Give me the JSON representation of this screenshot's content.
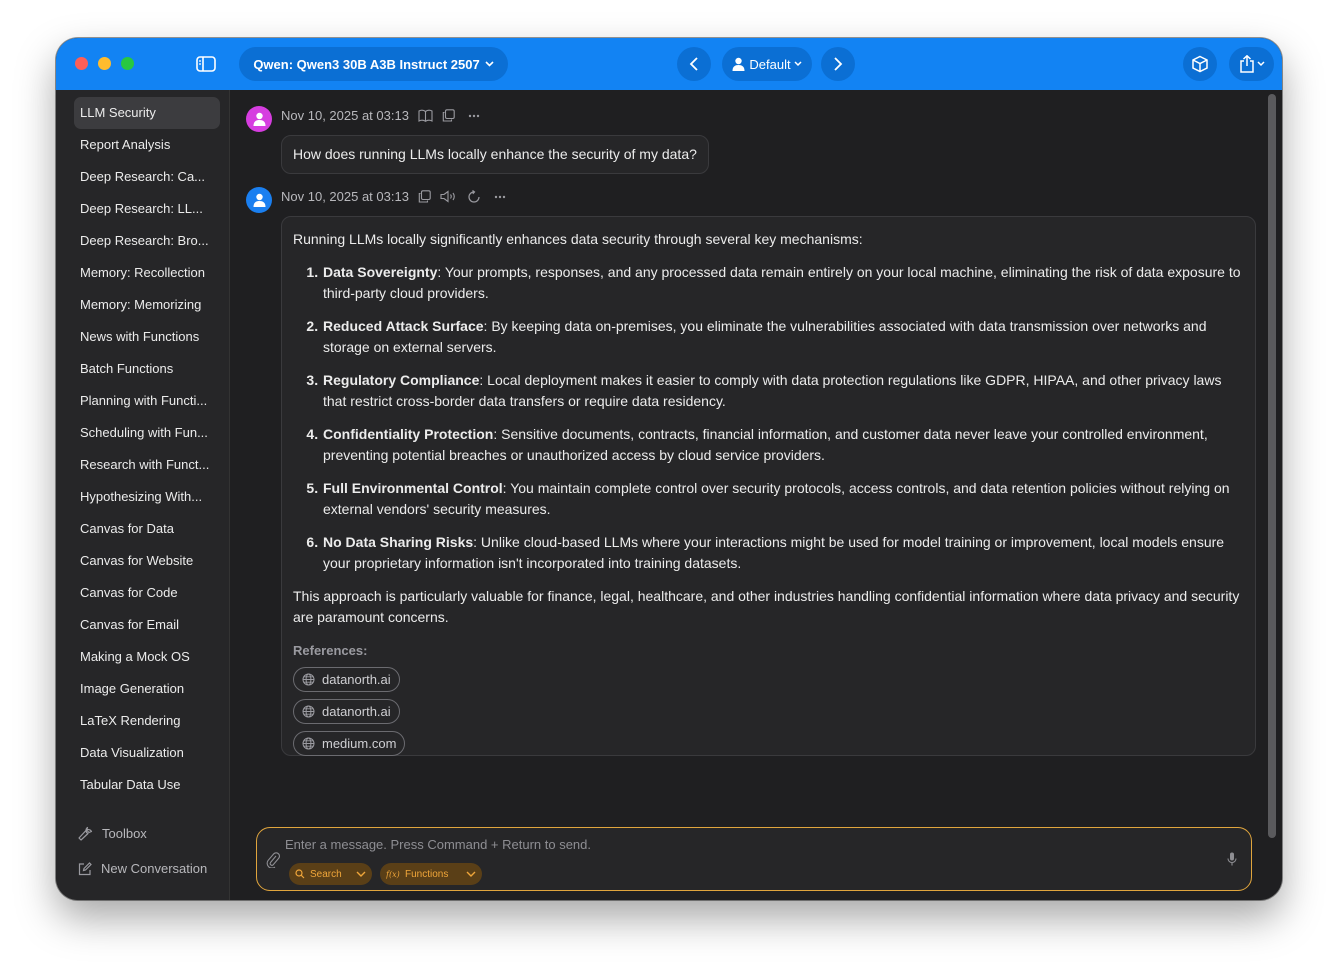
{
  "toolbar": {
    "model_label": "Qwen: Qwen3 30B A3B Instruct 2507",
    "profile_label": "Default"
  },
  "sidebar": {
    "items": [
      {
        "label": "LLM Security",
        "active": true
      },
      {
        "label": "Report Analysis"
      },
      {
        "label": "Deep Research: Ca..."
      },
      {
        "label": "Deep Research: LL..."
      },
      {
        "label": "Deep Research: Bro..."
      },
      {
        "label": "Memory: Recollection"
      },
      {
        "label": "Memory: Memorizing"
      },
      {
        "label": "News with Functions"
      },
      {
        "label": "Batch Functions"
      },
      {
        "label": "Planning with Functi..."
      },
      {
        "label": "Scheduling with Fun..."
      },
      {
        "label": "Research with Funct..."
      },
      {
        "label": "Hypothesizing With..."
      },
      {
        "label": "Canvas for Data"
      },
      {
        "label": "Canvas for Website"
      },
      {
        "label": "Canvas for Code"
      },
      {
        "label": "Canvas for Email"
      },
      {
        "label": "Making a Mock OS"
      },
      {
        "label": "Image Generation"
      },
      {
        "label": "LaTeX Rendering"
      },
      {
        "label": "Data Visualization"
      },
      {
        "label": "Tabular Data Use"
      }
    ],
    "toolbox_label": "Toolbox",
    "new_conversation_label": "New Conversation"
  },
  "conversation": {
    "user_message": {
      "timestamp": "Nov 10, 2025 at 03:13",
      "text": "How does running LLMs locally enhance the security of my data?"
    },
    "assistant_message": {
      "timestamp": "Nov 10, 2025 at 03:13",
      "intro": "Running LLMs locally significantly enhances data security through several key mechanisms:",
      "points": [
        {
          "title": "Data Sovereignty",
          "text": ": Your prompts, responses, and any processed data remain entirely on your local machine, eliminating the risk of data exposure to third-party cloud providers."
        },
        {
          "title": "Reduced Attack Surface",
          "text": ": By keeping data on-premises, you eliminate the vulnerabilities associated with data transmission over networks and storage on external servers."
        },
        {
          "title": "Regulatory Compliance",
          "text": ": Local deployment makes it easier to comply with data protection regulations like GDPR, HIPAA, and other privacy laws that restrict cross-border data transfers or require data residency."
        },
        {
          "title": "Confidentiality Protection",
          "text": ": Sensitive documents, contracts, financial information, and customer data never leave your controlled environment, preventing potential breaches or unauthorized access by cloud service providers."
        },
        {
          "title": "Full Environmental Control",
          "text": ": You maintain complete control over security protocols, access controls, and data retention policies without relying on external vendors' security measures."
        },
        {
          "title": "No Data Sharing Risks",
          "text": ": Unlike cloud-based LLMs where your interactions might be used for model training or improvement, local models ensure your proprietary information isn't incorporated into training datasets."
        }
      ],
      "conclusion": "This approach is particularly valuable for finance, legal, healthcare, and other industries handling confidential information where data privacy and security are paramount concerns.",
      "references_label": "References:",
      "references": [
        "datanorth.ai",
        "datanorth.ai",
        "medium.com"
      ]
    }
  },
  "composer": {
    "placeholder": "Enter a message. Press Command + Return to send.",
    "search_label": "Search",
    "functions_label": "Functions"
  },
  "colors": {
    "titlebar": "#1283f3",
    "accent_border": "#e0a53d",
    "user_avatar": "#d63de0",
    "assistant_avatar": "#1a7ff0"
  }
}
